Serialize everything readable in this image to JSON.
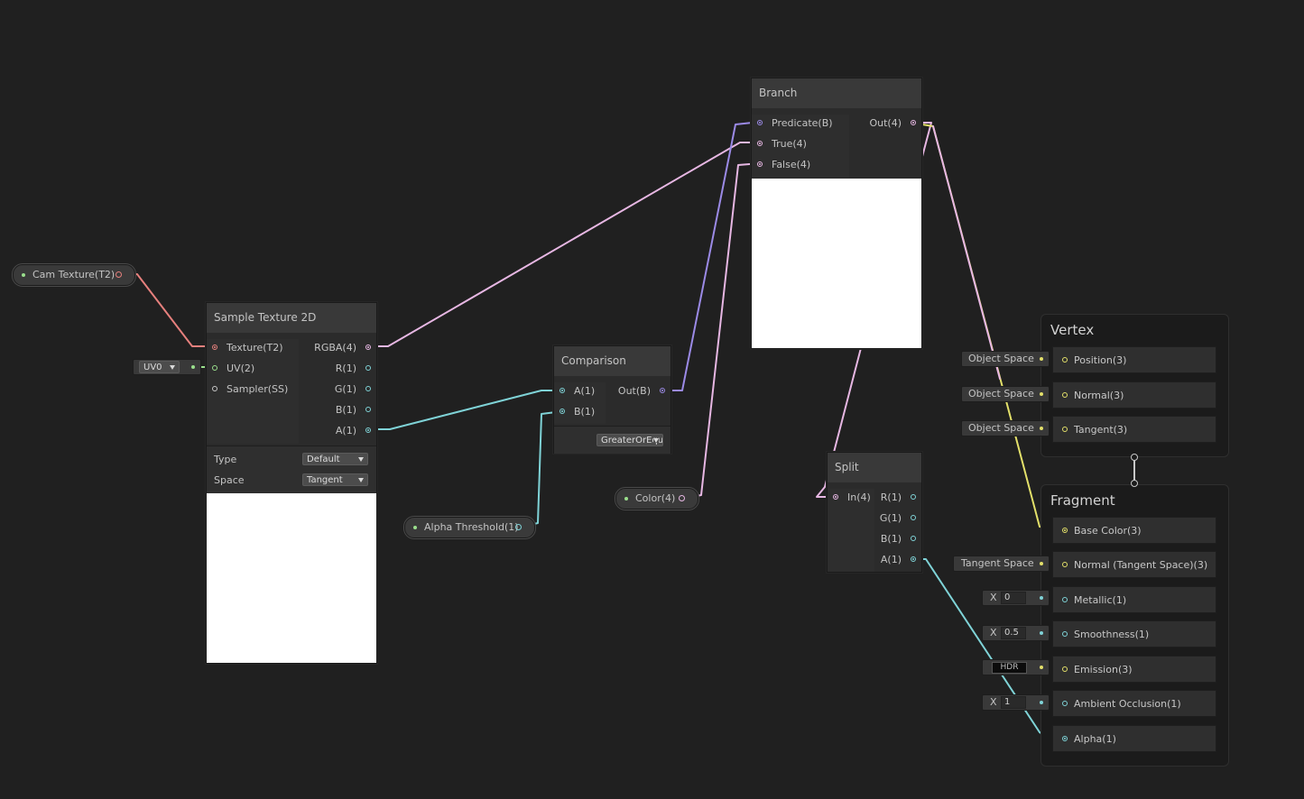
{
  "colors": {
    "texture": "#e6807d",
    "vector2": "#9adf8c",
    "vector4": "#e7b7e3",
    "vector1": "#7fd3d7",
    "boolean": "#9b8ae6",
    "vector3": "#e3e06a",
    "sampler": "#c8c8c8"
  },
  "cam_texture": {
    "label": "Cam Texture(T2)"
  },
  "uv_dropdown": {
    "value": "UV0"
  },
  "sample_texture": {
    "title": "Sample Texture 2D",
    "inputs": [
      "Texture(T2)",
      "UV(2)",
      "Sampler(SS)"
    ],
    "outputs": [
      "RGBA(4)",
      "R(1)",
      "G(1)",
      "B(1)",
      "A(1)"
    ],
    "type_label": "Type",
    "type_value": "Default",
    "space_label": "Space",
    "space_value": "Tangent"
  },
  "alpha_threshold": {
    "label": "Alpha Threshold(1)"
  },
  "comparison": {
    "title": "Comparison",
    "inputs": [
      "A(1)",
      "B(1)"
    ],
    "outputs": [
      "Out(B)"
    ],
    "mode": "GreaterOrEqual"
  },
  "color_prop": {
    "label": "Color(4)"
  },
  "branch": {
    "title": "Branch",
    "inputs": [
      "Predicate(B)",
      "True(4)",
      "False(4)"
    ],
    "outputs": [
      "Out(4)"
    ]
  },
  "split": {
    "title": "Split",
    "inputs": [
      "In(4)"
    ],
    "outputs": [
      "R(1)",
      "G(1)",
      "B(1)",
      "A(1)"
    ]
  },
  "vertex": {
    "title": "Vertex",
    "blocks": [
      {
        "label": "Position(3)",
        "control": "Object Space"
      },
      {
        "label": "Normal(3)",
        "control": "Object Space"
      },
      {
        "label": "Tangent(3)",
        "control": "Object Space"
      }
    ]
  },
  "fragment": {
    "title": "Fragment",
    "blocks": [
      {
        "label": "Base Color(3)"
      },
      {
        "label": "Normal (Tangent Space)(3)",
        "control": "Tangent Space"
      },
      {
        "label": "Metallic(1)",
        "axis": "X",
        "value": "0"
      },
      {
        "label": "Smoothness(1)",
        "axis": "X",
        "value": "0.5"
      },
      {
        "label": "Emission(3)",
        "control": "HDR"
      },
      {
        "label": "Ambient Occlusion(1)",
        "axis": "X",
        "value": "1"
      },
      {
        "label": "Alpha(1)"
      }
    ]
  }
}
